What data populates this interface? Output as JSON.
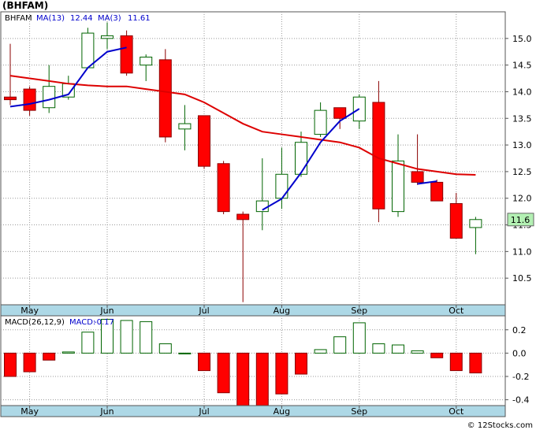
{
  "header": {
    "title": "(BHFAM)"
  },
  "colors": {
    "up_fill": "#ffffff",
    "up_stroke": "#006400",
    "down_fill": "#ff0000",
    "down_stroke": "#8b0000",
    "ma_short": "#0000cc",
    "ma_long": "#dd0000",
    "axis_band": "#add8e6",
    "grid": "#999999",
    "last_label_bg": "#b3f0b3"
  },
  "chart_data": [
    {
      "type": "candlestick",
      "ticker": "BHFAM",
      "legend": {
        "ticker": "BHFAM",
        "ma_long_label": "MA(13)",
        "ma_long_value": "12.44",
        "ma_short_label": "MA(3)",
        "ma_short_value": "11.61"
      },
      "x_labels": [
        "May",
        "Jun",
        "Jul",
        "Aug",
        "Sep",
        "Oct"
      ],
      "x_label_index": [
        1,
        5,
        10,
        14,
        18,
        23
      ],
      "y_ticks": [
        10.5,
        11.0,
        11.5,
        12.0,
        12.5,
        13.0,
        13.5,
        14.0,
        14.5,
        15.0
      ],
      "y_tick_labels": [
        "10.5",
        "11.0",
        "11.5",
        "12.0",
        "12.5",
        "13.0",
        "13.5",
        "14.0",
        "14.5",
        "15.0"
      ],
      "ylim": [
        10.0,
        15.5
      ],
      "last_price_label": "11.6",
      "last_price": 11.6,
      "candles": [
        {
          "o": 13.9,
          "h": 14.9,
          "l": 13.75,
          "c": 13.85
        },
        {
          "o": 14.05,
          "h": 14.1,
          "l": 13.55,
          "c": 13.65
        },
        {
          "o": 13.7,
          "h": 14.5,
          "l": 13.6,
          "c": 14.1
        },
        {
          "o": 13.9,
          "h": 14.3,
          "l": 13.85,
          "c": 14.15
        },
        {
          "o": 14.45,
          "h": 15.2,
          "l": 14.45,
          "c": 15.1
        },
        {
          "o": 15.0,
          "h": 15.3,
          "l": 14.8,
          "c": 15.05
        },
        {
          "o": 15.05,
          "h": 15.15,
          "l": 14.3,
          "c": 14.35
        },
        {
          "o": 14.5,
          "h": 14.7,
          "l": 14.2,
          "c": 14.65
        },
        {
          "o": 14.6,
          "h": 14.8,
          "l": 13.05,
          "c": 13.15
        },
        {
          "o": 13.3,
          "h": 13.75,
          "l": 12.9,
          "c": 13.4
        },
        {
          "o": 13.55,
          "h": 13.55,
          "l": 12.55,
          "c": 12.6
        },
        {
          "o": 12.65,
          "h": 12.7,
          "l": 11.7,
          "c": 11.75
        },
        {
          "o": 11.7,
          "h": 11.75,
          "l": 10.05,
          "c": 11.6
        },
        {
          "o": 11.75,
          "h": 12.75,
          "l": 11.4,
          "c": 11.95
        },
        {
          "o": 12.0,
          "h": 12.95,
          "l": 11.8,
          "c": 12.45
        },
        {
          "o": 12.45,
          "h": 13.25,
          "l": 12.4,
          "c": 13.05
        },
        {
          "o": 13.2,
          "h": 13.8,
          "l": 13.15,
          "c": 13.65
        },
        {
          "o": 13.7,
          "h": 13.7,
          "l": 13.3,
          "c": 13.5
        },
        {
          "o": 13.45,
          "h": 13.95,
          "l": 13.3,
          "c": 13.9
        },
        {
          "o": 13.8,
          "h": 14.2,
          "l": 11.55,
          "c": 11.8
        },
        {
          "o": 11.75,
          "h": 13.2,
          "l": 11.65,
          "c": 12.7
        },
        {
          "o": 12.5,
          "h": 13.2,
          "l": 12.25,
          "c": 12.3
        },
        {
          "o": 12.3,
          "h": 12.35,
          "l": 11.95,
          "c": 11.95
        },
        {
          "o": 11.9,
          "h": 12.1,
          "l": 11.25,
          "c": 11.25
        },
        {
          "o": 11.45,
          "h": 11.65,
          "l": 10.95,
          "c": 11.6
        }
      ],
      "ma_short": {
        "name": "MA(3)",
        "start_index": 0,
        "values": [
          13.72,
          13.77,
          13.85,
          13.95,
          14.45,
          14.75,
          14.83,
          null,
          null,
          null,
          null,
          null,
          null,
          11.78,
          11.99,
          12.48,
          13.05,
          13.45,
          13.68,
          null,
          null,
          12.27,
          12.32,
          null,
          null
        ]
      },
      "ma_long": {
        "name": "MA(13)",
        "start_index": 0,
        "values": [
          14.3,
          14.25,
          14.2,
          14.15,
          14.12,
          14.1,
          14.1,
          14.05,
          14.0,
          13.95,
          13.8,
          13.6,
          13.4,
          13.25,
          13.2,
          13.15,
          13.1,
          13.05,
          12.95,
          12.75,
          12.65,
          12.55,
          12.5,
          12.45,
          12.44
        ]
      }
    },
    {
      "type": "bar",
      "legend": {
        "name": "MACD(26,12,9)",
        "value_label": "MACD:",
        "value": "-0.17"
      },
      "x_labels": [
        "May",
        "Jun",
        "Jul",
        "Aug",
        "Sep",
        "Oct"
      ],
      "x_label_index": [
        1,
        5,
        10,
        14,
        18,
        23
      ],
      "y_ticks": [
        -0.4,
        -0.2,
        0.0,
        0.2
      ],
      "y_tick_labels": [
        "-0.4",
        "-0.2",
        "0.0",
        "0.2"
      ],
      "ylim": [
        -0.45,
        0.32
      ],
      "values": [
        -0.2,
        -0.16,
        -0.06,
        0.01,
        0.18,
        0.29,
        0.28,
        0.27,
        0.08,
        0.0,
        -0.15,
        -0.34,
        -0.47,
        -0.46,
        -0.35,
        -0.18,
        0.03,
        0.14,
        0.26,
        0.08,
        0.07,
        0.02,
        -0.04,
        -0.15,
        -0.17
      ]
    }
  ],
  "footer": {
    "watermark": "© 12Stocks.com"
  }
}
